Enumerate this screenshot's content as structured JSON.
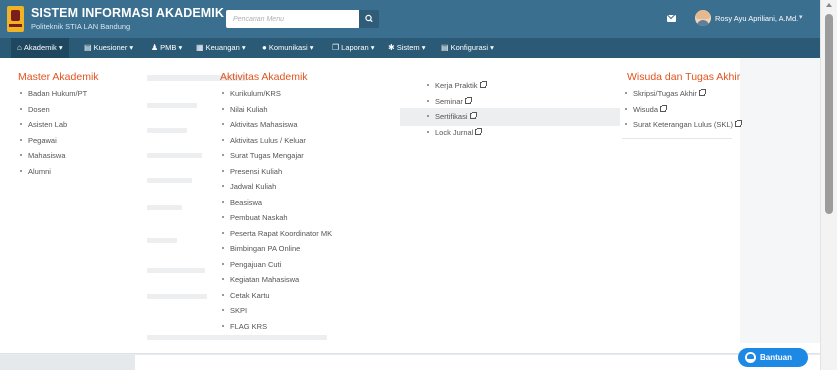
{
  "header": {
    "title": "SISTEM INFORMASI AKADEMIK",
    "subtitle": "Politeknik STIA LAN Bandung",
    "search_placeholder": "Pencarian Menu",
    "user_name": "Rosy Ayu Apriliani, A.Md.",
    "accent_color": "#3a6f8f"
  },
  "nav": {
    "items": [
      {
        "label": "Akademik",
        "icon": "bank-icon",
        "active": true
      },
      {
        "label": "Kuesioner",
        "icon": "file-icon"
      },
      {
        "label": "PMB",
        "icon": "users-icon"
      },
      {
        "label": "Keuangan",
        "icon": "money-icon"
      },
      {
        "label": "Komunikasi",
        "icon": "chat-icon"
      },
      {
        "label": "Laporan",
        "icon": "copy-icon"
      },
      {
        "label": "Sistem",
        "icon": "gear-icon"
      },
      {
        "label": "Konfigurasi",
        "icon": "list-icon"
      }
    ]
  },
  "mega_menu": {
    "master": {
      "title": "Master Akademik",
      "items": [
        "Badan Hukum/PT",
        "Dosen",
        "Asisten Lab",
        "Pegawai",
        "Mahasiswa",
        "Alumni"
      ]
    },
    "aktivitas": {
      "title": "Aktivitas Akademik",
      "items": [
        "Kurikulum/KRS",
        "Nilai Kuliah",
        "Aktivitas Mahasiswa",
        "Aktivitas Lulus / Keluar",
        "Surat Tugas Mengajar",
        "Presensi Kuliah",
        "Jadwal Kuliah",
        "Beasiswa",
        "Pembuat Naskah",
        "Peserta Rapat Koordinator MK",
        "Bimbingan PA Online",
        "Pengajuan Cuti",
        "Kegiatan Mahasiswa",
        "Cetak Kartu",
        "SKPI",
        "FLAG KRS"
      ]
    },
    "lainnya": {
      "items": [
        "Kerja Praktik",
        "Seminar",
        "Sertifikasi",
        "Lock Jurnal"
      ]
    },
    "wisuda": {
      "title": "Wisuda dan Tugas Akhir",
      "items": [
        "Skripsi/Tugas Akhir",
        "Wisuda",
        "Surat Keterangan Lulus (SKL)"
      ]
    }
  },
  "help_button": {
    "label": "Bantuan",
    "color": "#1e88e5"
  }
}
